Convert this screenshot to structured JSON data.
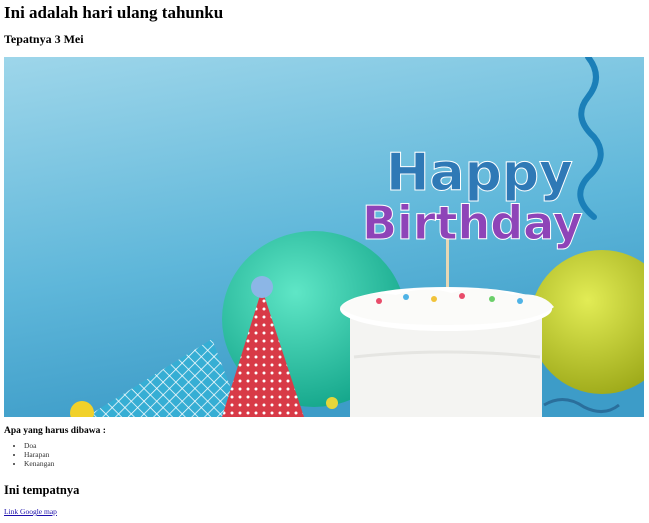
{
  "page": {
    "title": "Ini adalah hari ulang tahunku",
    "subtitle": "Tepatnya 3 Mei",
    "image": {
      "topper_line1": "Happy",
      "topper_line2": "Birthday",
      "colors": {
        "sky_top": "#8ccde6",
        "sky_bottom": "#4aa7cf",
        "balloon_teal": "#27c9a8",
        "balloon_yellow": "#c8d42a",
        "cake_white": "#f6f6f4",
        "hat_blue": "#3bb0d6",
        "hat_red": "#d93b48",
        "streamer": "#1b7fb8"
      }
    },
    "bring_label": "Apa yang harus dibawa :",
    "bring_items": [
      "Doa",
      "Harapan",
      "Kenangan"
    ],
    "place_heading": "Ini tempatnya",
    "map_link_text": "Link Google map"
  }
}
